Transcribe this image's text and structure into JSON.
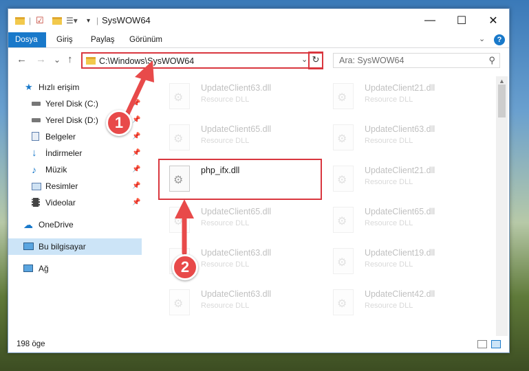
{
  "window": {
    "title": "SysWOW64",
    "controls": {
      "minimize": "—",
      "maximize": "☐",
      "close": "✕"
    }
  },
  "ribbon": {
    "tabs": [
      {
        "label": "Dosya",
        "active": true
      },
      {
        "label": "Giriş"
      },
      {
        "label": "Paylaş"
      },
      {
        "label": "Görünüm"
      }
    ],
    "expand_icon": "chevron-down-icon",
    "help_label": "?"
  },
  "navigation": {
    "back": "←",
    "forward": "→",
    "recent": "⌄",
    "up": "↑",
    "address": "C:\\Windows\\SysWOW64",
    "refresh": "↻",
    "search_placeholder": "Ara: SysWOW64"
  },
  "sidebar": {
    "items": [
      {
        "label": "Hızlı erişim",
        "icon": "star-icon"
      },
      {
        "label": "Yerel Disk (C:)",
        "icon": "drive-icon",
        "pinned": true
      },
      {
        "label": "Yerel Disk (D:)",
        "icon": "drive-icon",
        "pinned": true
      },
      {
        "label": "Belgeler",
        "icon": "documents-icon",
        "pinned": true
      },
      {
        "label": "İndirmeler",
        "icon": "download-icon",
        "pinned": true
      },
      {
        "label": "Müzik",
        "icon": "music-icon",
        "pinned": true
      },
      {
        "label": "Resimler",
        "icon": "pictures-icon",
        "pinned": true
      },
      {
        "label": "Videolar",
        "icon": "videos-icon",
        "pinned": true
      },
      {
        "label": "OneDrive",
        "icon": "cloud-icon"
      },
      {
        "label": "Bu bilgisayar",
        "icon": "computer-icon",
        "selected": true
      },
      {
        "label": "Ağ",
        "icon": "network-icon"
      }
    ]
  },
  "files": [
    {
      "name": "UpdateClient63.dll",
      "type": "Resource DLL",
      "faded": true
    },
    {
      "name": "UpdateClient21.dll",
      "type": "Resource DLL",
      "faded": true
    },
    {
      "name": "UpdateClient65.dll",
      "type": "Resource DLL",
      "faded": true
    },
    {
      "name": "UpdateClient63.dll",
      "type": "Resource DLL",
      "faded": true
    },
    {
      "name": "php_ifx.dll",
      "type": "",
      "faded": false,
      "highlighted": true
    },
    {
      "name": "UpdateClient21.dll",
      "type": "Resource DLL",
      "faded": true
    },
    {
      "name": "UpdateClient65.dll",
      "type": "Resource DLL",
      "faded": true
    },
    {
      "name": "UpdateClient65.dll",
      "type": "Resource DLL",
      "faded": true
    },
    {
      "name": "UpdateClient63.dll",
      "type": "Resource DLL",
      "faded": true
    },
    {
      "name": "UpdateClient19.dll",
      "type": "Resource DLL",
      "faded": true
    },
    {
      "name": "UpdateClient63.dll",
      "type": "Resource DLL",
      "faded": true
    },
    {
      "name": "UpdateClient42.dll",
      "type": "Resource DLL",
      "faded": true
    }
  ],
  "status": {
    "item_count": "198 öge"
  },
  "annotations": {
    "step1": "1",
    "step2": "2",
    "color": "#e84a4a"
  }
}
